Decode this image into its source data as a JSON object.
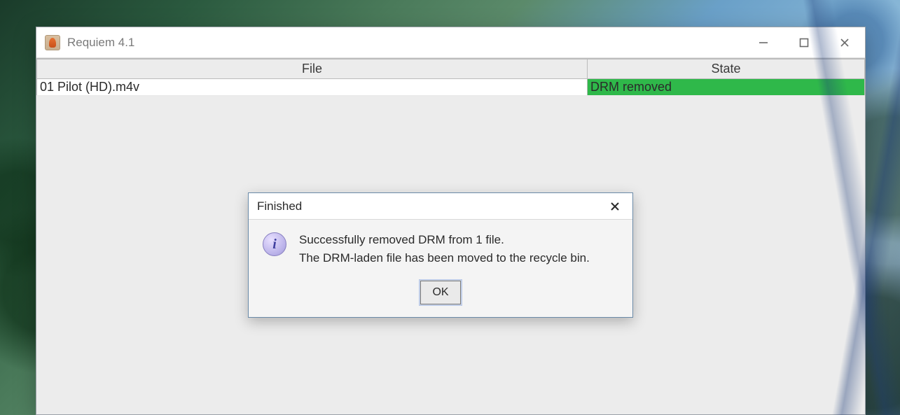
{
  "window": {
    "title": "Requiem 4.1"
  },
  "table": {
    "headers": {
      "file": "File",
      "state": "State"
    },
    "rows": [
      {
        "file": "01 Pilot (HD).m4v",
        "state": "DRM removed",
        "state_kind": "success"
      }
    ]
  },
  "dialog": {
    "title": "Finished",
    "line1": "Successfully removed DRM from 1 file.",
    "line2": "The DRM-laden file has been moved to the recycle bin.",
    "ok_label": "OK",
    "info_glyph": "i"
  },
  "colors": {
    "success_bg": "#2fb84a"
  }
}
